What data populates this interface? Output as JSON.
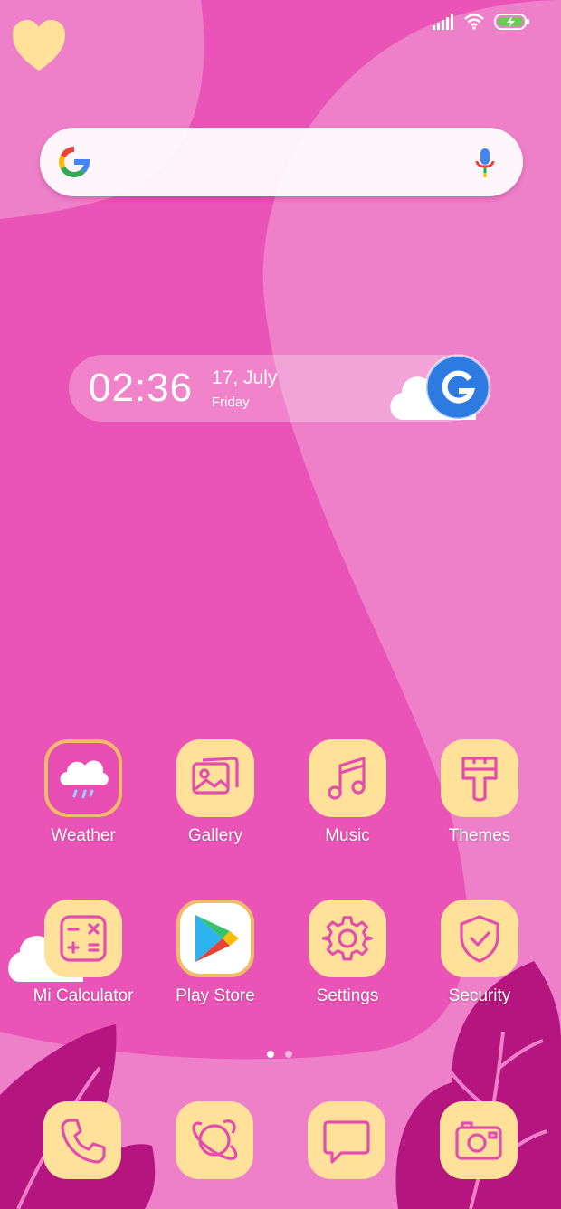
{
  "colors": {
    "wallpaper_base": "#ea54b6",
    "wallpaper_light": "#ee80c9",
    "plant_dark": "#b5157e",
    "tile_fill": "#ffe19a",
    "icon_stroke": "#e34eae"
  },
  "status_bar": {
    "signal_icon": "signal-bars-icon",
    "wifi_icon": "wifi-icon",
    "battery_icon": "battery-charging-icon"
  },
  "search": {
    "logo_icon": "google-g-icon",
    "voice_icon": "microphone-icon"
  },
  "clock": {
    "time": "02:36",
    "date": "17, July",
    "day": "Friday"
  },
  "apps": [
    {
      "label": "Weather",
      "icon": "rain-cloud-icon"
    },
    {
      "label": "Gallery",
      "icon": "gallery-photos-icon"
    },
    {
      "label": "Music",
      "icon": "music-note-icon"
    },
    {
      "label": "Themes",
      "icon": "paint-brush-icon"
    },
    {
      "label": "Mi Calculator",
      "icon": "calculator-icon"
    },
    {
      "label": "Play Store",
      "icon": "play-store-icon"
    },
    {
      "label": "Settings",
      "icon": "gear-icon"
    },
    {
      "label": "Security",
      "icon": "shield-check-icon"
    }
  ],
  "page_indicator": {
    "pages": 2,
    "current": 1
  },
  "dock": [
    {
      "icon": "phone-icon"
    },
    {
      "icon": "browser-planet-icon"
    },
    {
      "icon": "messages-icon"
    },
    {
      "icon": "camera-icon"
    }
  ]
}
